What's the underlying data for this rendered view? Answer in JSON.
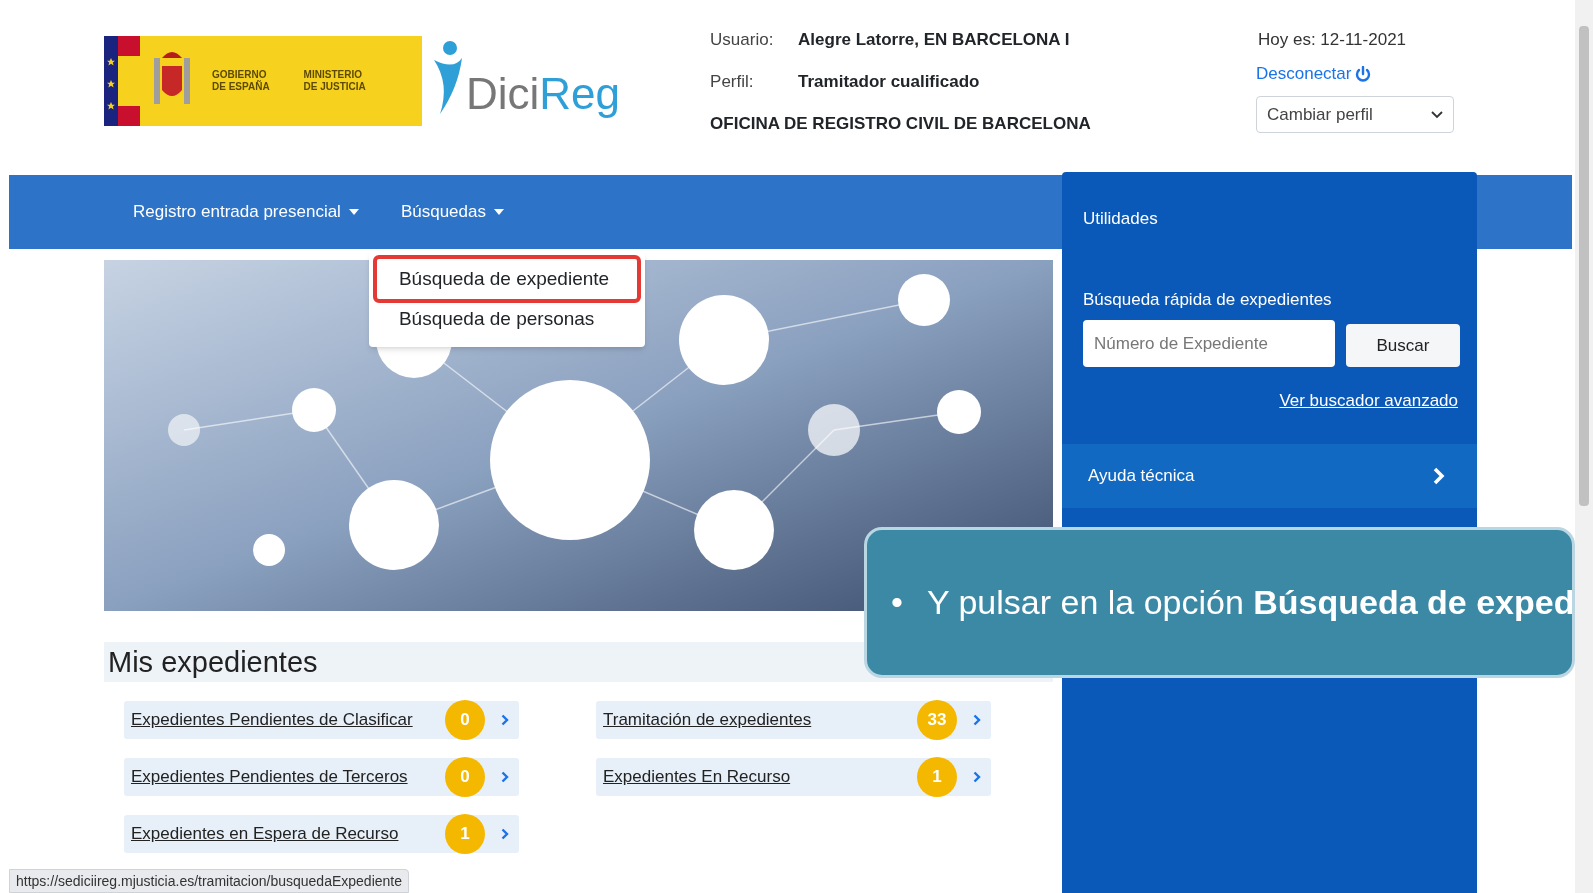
{
  "header": {
    "logo": {
      "line_1": "GOBIERNO",
      "line_2": "DE ESPAÑA",
      "line_3": "MINISTERIO",
      "line_4": "DE JUSTICIA",
      "app_name_1": "Dici",
      "app_name_2": "Reg"
    },
    "user_label": "Usuario:",
    "user_value": "Alegre Latorre, EN BARCELONA I",
    "profile_label": "Perfil:",
    "profile_value": "Tramitador cualificado",
    "office": "OFICINA DE REGISTRO CIVIL DE BARCELONA",
    "date": "Hoy es: 12-11-2021",
    "logout": "Desconectar",
    "profile_select": "Cambiar perfil"
  },
  "nav": {
    "items": [
      {
        "label": "Registro entrada presencial",
        "expanded": false
      },
      {
        "label": "Búsquedas",
        "expanded": true,
        "menu": [
          {
            "label": "Búsqueda de expediente",
            "selected": true
          },
          {
            "label": "Búsqueda de personas",
            "selected": false
          }
        ]
      }
    ]
  },
  "utilities": {
    "title": "Utilidades",
    "quick_search_title": "Búsqueda rápida de expedientes",
    "placeholder": "Número de Expediente",
    "button": "Buscar",
    "advanced_link": "Ver buscador avanzado",
    "help": "Ayuda técnica"
  },
  "mis_expedientes": {
    "title": "Mis expedientes",
    "columns": [
      [
        {
          "label": "Expedientes Pendientes de Clasificar",
          "count": "0"
        },
        {
          "label": "Expedientes Pendientes de Terceros",
          "count": "0"
        },
        {
          "label": "Expedientes en Espera de Recurso",
          "count": "1"
        }
      ],
      [
        {
          "label": "Tramitación de expedientes",
          "count": "33"
        },
        {
          "label": "Expedientes En Recurso",
          "count": "1"
        }
      ]
    ]
  },
  "status_url": "https://sediciireg.mjusticia.es/tramitacion/busquedaExpediente",
  "callout": {
    "bullet": "•",
    "text": "Y pulsar en la opción **Búsqueda de exped**"
  }
}
